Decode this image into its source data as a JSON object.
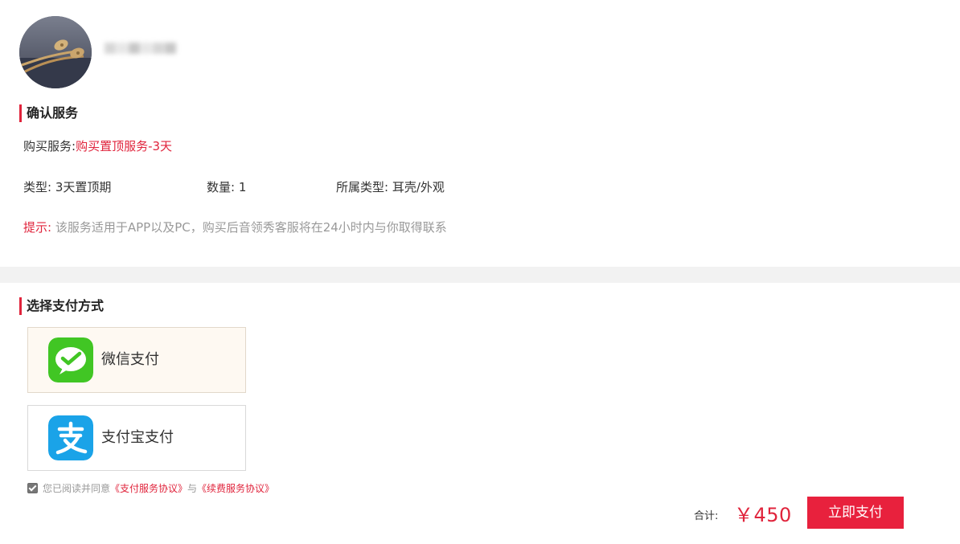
{
  "user": {
    "avatar_icon": "earphones-avatar-image",
    "name_masked": true
  },
  "confirm_section": {
    "title": "确认服务",
    "service_label": "购买服务:",
    "service_value": "购买置顶服务-3天",
    "type_label": "类型:",
    "type_value": "3天置顶期",
    "quantity_label": "数量:",
    "quantity_value": "1",
    "category_label": "所属类型:",
    "category_value": "耳壳/外观",
    "tip_label": "提示:",
    "tip_text": "该服务适用于APP以及PC，购买后音领秀客服将在24小时内与你取得联系"
  },
  "payment_section": {
    "title": "选择支付方式",
    "methods": [
      {
        "label": "微信支付",
        "icon": "wechat-pay-icon",
        "color": "#41c624",
        "selected": true
      },
      {
        "label": "支付宝支付",
        "icon": "alipay-icon",
        "color": "#1aa3e8",
        "selected": false
      }
    ],
    "agreement": {
      "checked": true,
      "prefix": "您已阅读并同意",
      "link1": "《支付服务协议》",
      "middle": "与",
      "link2": "《续费服务协议》"
    }
  },
  "footer": {
    "total_label": "合计:",
    "total_amount": "￥450",
    "pay_button": "立即支付"
  },
  "colors": {
    "accent": "#e0243c",
    "divider": "#f2f2f2",
    "selected_bg": "#fef9f2"
  }
}
